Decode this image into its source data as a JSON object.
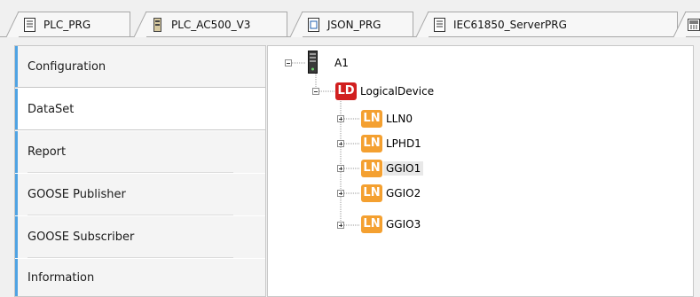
{
  "tabs": [
    {
      "label": "PLC_PRG",
      "icon": "document-icon"
    },
    {
      "label": "PLC_AC500_V3",
      "icon": "device-icon"
    },
    {
      "label": "JSON_PRG",
      "icon": "function-block-icon"
    },
    {
      "label": "IEC61850_ServerPRG",
      "icon": "document-icon"
    },
    {
      "label": "",
      "icon": "network-icon"
    }
  ],
  "nav": {
    "selected": "DataSet",
    "items": [
      {
        "label": "Configuration"
      },
      {
        "label": "DataSet"
      },
      {
        "label": "Report"
      },
      {
        "label": "GOOSE Publisher"
      },
      {
        "label": "GOOSE Subscriber"
      },
      {
        "label": "Information"
      }
    ]
  },
  "tree": {
    "root": {
      "label": "A1",
      "icon": "server-icon",
      "expanded": true
    },
    "logical_device": {
      "badge": "LD",
      "label": "LogicalDevice",
      "expanded": true
    },
    "logical_nodes": [
      {
        "badge": "LN",
        "label": "LLN0",
        "expanded": false,
        "selected": false
      },
      {
        "badge": "LN",
        "label": "LPHD1",
        "expanded": false,
        "selected": false
      },
      {
        "badge": "LN",
        "label": "GGIO1",
        "expanded": false,
        "selected": true
      },
      {
        "badge": "LN",
        "label": "GGIO2",
        "expanded": false,
        "selected": false
      },
      {
        "badge": "LN",
        "label": "GGIO3",
        "expanded": false,
        "selected": false
      }
    ]
  },
  "colors": {
    "accent": "#4fa3e3",
    "ld_badge": "#d11f1f",
    "ln_badge": "#f4a030"
  }
}
